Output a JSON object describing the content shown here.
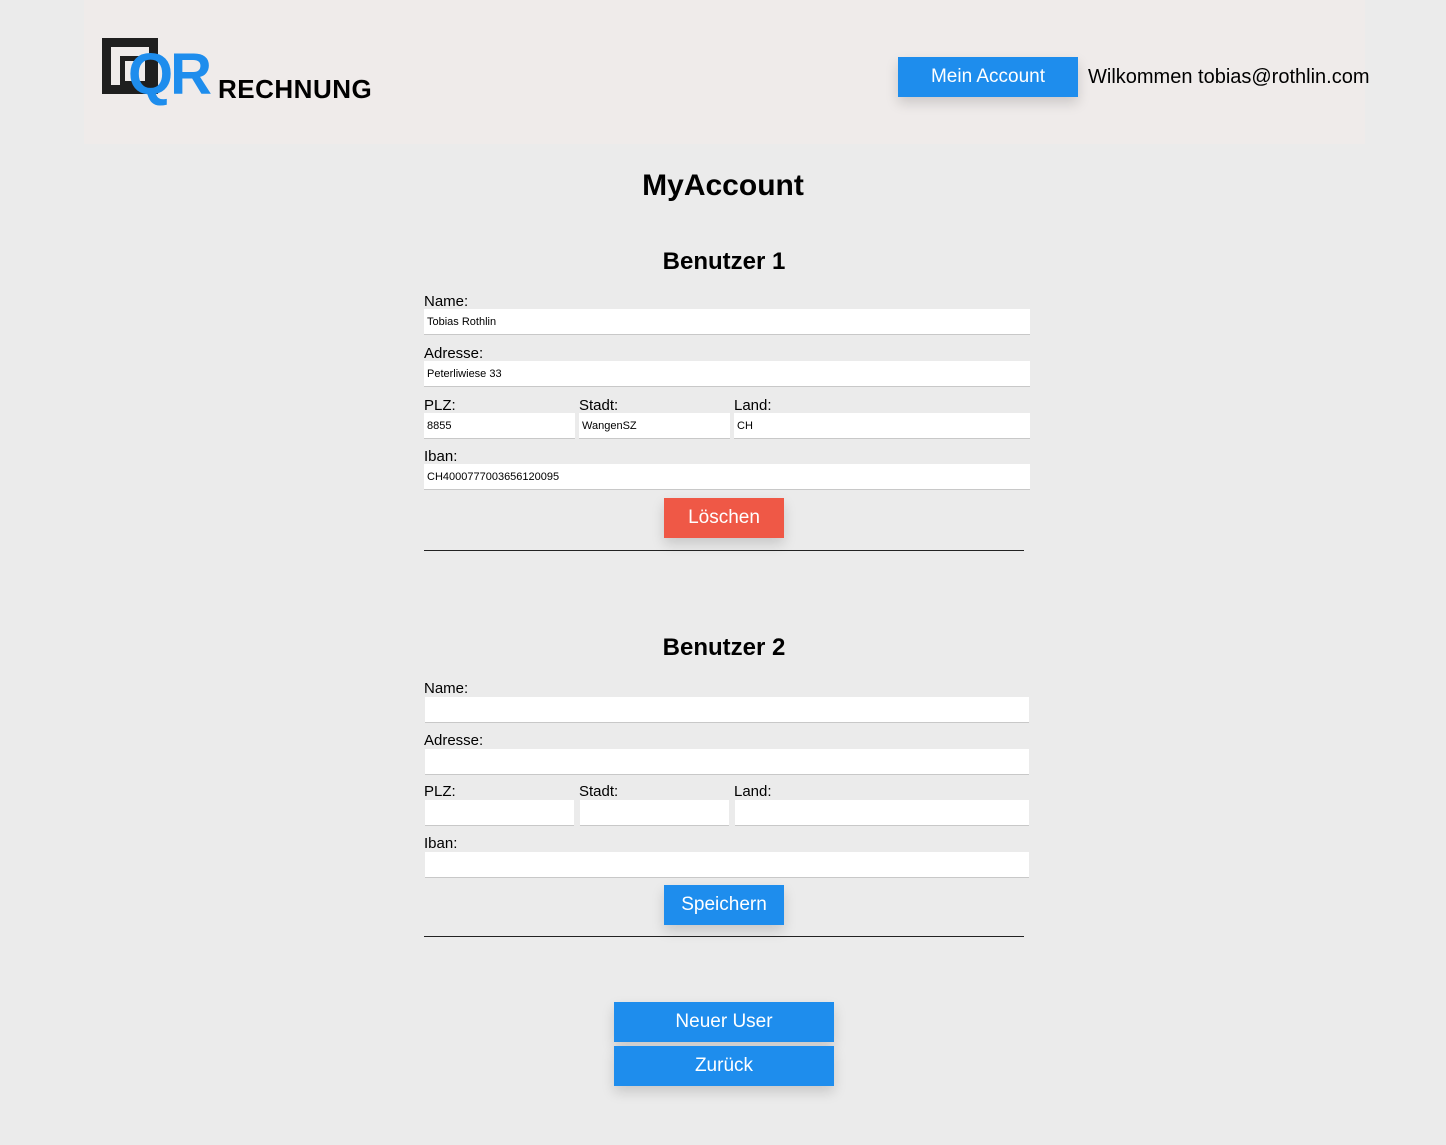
{
  "header": {
    "logo_qr": "QR",
    "logo_text": "RECHNUNG",
    "account_button": "Mein Account",
    "welcome": "Wilkommen tobias@rothlin.com"
  },
  "page_title": "MyAccount",
  "labels": {
    "name": "Name:",
    "address": "Adresse:",
    "plz": "PLZ:",
    "city": "Stadt:",
    "country": "Land:",
    "iban": "Iban:"
  },
  "users": [
    {
      "title": "Benutzer 1",
      "name": "Tobias Rothlin",
      "address": "Peterliwiese 33",
      "plz": "8855",
      "city": "WangenSZ",
      "country": "CH",
      "iban": "CH4000777003656120095",
      "action_label": "Löschen"
    },
    {
      "title": "Benutzer 2",
      "name": "",
      "address": "",
      "plz": "",
      "city": "",
      "country": "",
      "iban": "",
      "action_label": "Speichern"
    }
  ],
  "footer": {
    "new_user_button": "Neuer User",
    "back_button": "Zurück"
  },
  "colors": {
    "accent": "#1e8ded",
    "danger": "#ef5846",
    "background": "#ebebeb",
    "header_bg": "#efebea"
  }
}
